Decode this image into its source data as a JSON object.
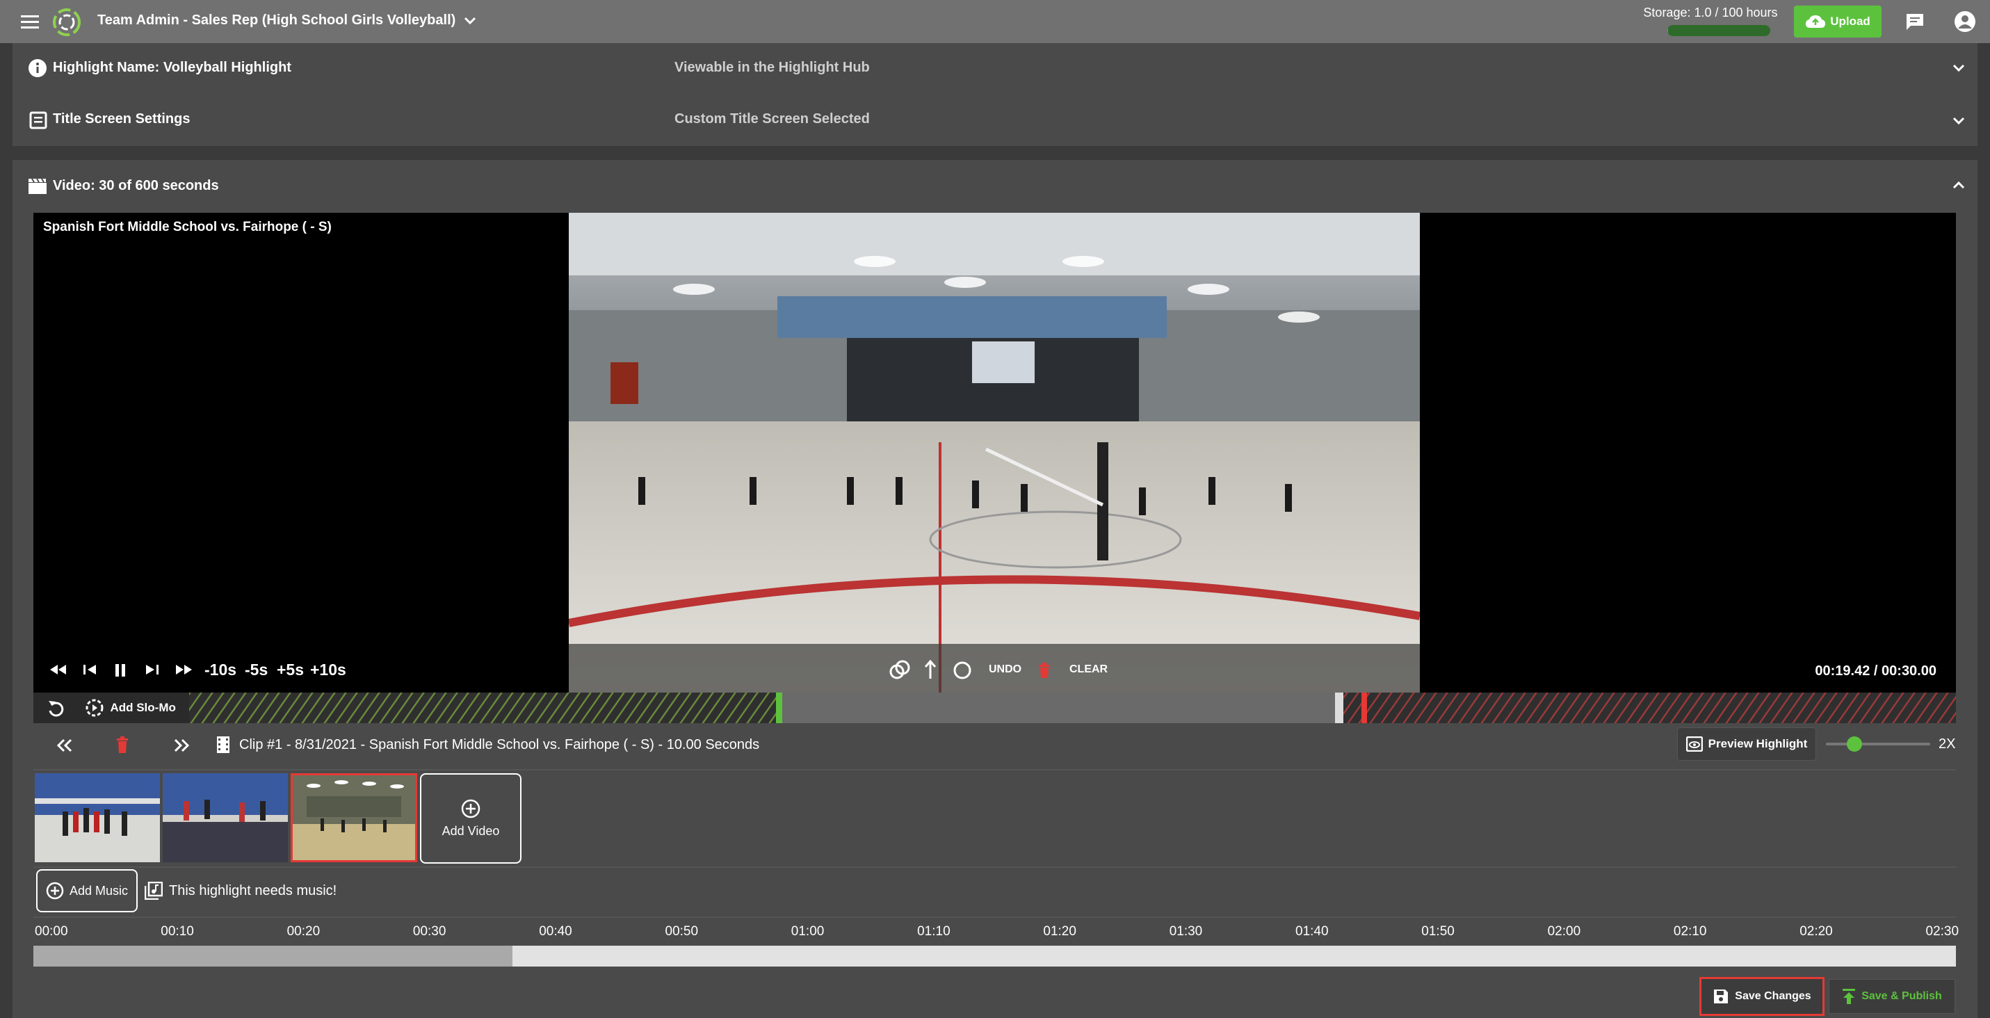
{
  "header": {
    "title": "Team Admin - Sales Rep (High School Girls Volleyball)",
    "storage_label": "Storage: 1.0 / 100 hours",
    "storage_fraction": 0.01,
    "upload_label": "Upload"
  },
  "highlight_name": {
    "label": "Highlight Name: Volleyball Highlight",
    "status": "Viewable in the Highlight Hub"
  },
  "title_screen": {
    "label": "Title Screen Settings",
    "status": "Custom Title Screen Selected"
  },
  "video_section": {
    "label": "Video: 30 of 600 seconds"
  },
  "player": {
    "game_title": "Spanish Fort Middle School vs. Fairhope ( - S)",
    "skip_minus_10": "-10s",
    "skip_minus_5": "-5s",
    "skip_plus_5": "+5s",
    "skip_plus_10": "+10s",
    "undo_label": "UNDO",
    "clear_label": "CLEAR",
    "time_readout": "00:19.42 / 00:30.00",
    "add_slomo_label": "Add Slo-Mo"
  },
  "clip_bar": {
    "clip_info": "Clip #1 - 8/31/2021 - Spanish Fort Middle School vs. Fairhope ( - S) - 10.00 Seconds",
    "preview_label": "Preview Highlight",
    "speed_label": "2X",
    "speed_fraction": 0.27
  },
  "clips": {
    "add_video_label": "Add Video"
  },
  "music": {
    "add_music_label": "Add Music",
    "needs_music_text": "This highlight needs music!"
  },
  "timeline": {
    "ticks": [
      "00:00",
      "00:10",
      "00:20",
      "00:30",
      "00:40",
      "00:50",
      "01:00",
      "01:10",
      "01:20",
      "01:30",
      "01:40",
      "01:50",
      "02:00",
      "02:10",
      "02:20",
      "02:30"
    ],
    "filled_seconds": 38
  },
  "actions": {
    "save_label": "Save Changes",
    "publish_label": "Save & Publish"
  },
  "colors": {
    "accent_green": "#5cc23d",
    "highlight_red": "#e53935",
    "topbar": "#717171"
  }
}
